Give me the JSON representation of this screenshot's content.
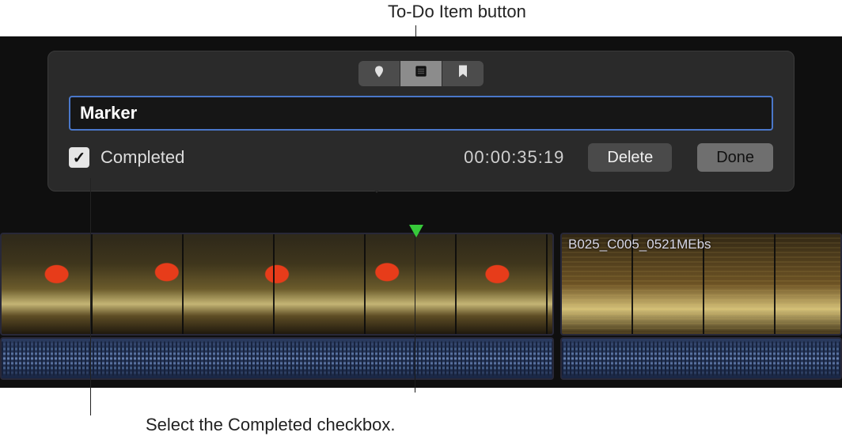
{
  "annotations": {
    "top": "To-Do Item button",
    "bottom": "Select the Completed checkbox."
  },
  "popover": {
    "segmented": {
      "standard_marker_icon": "marker-standard-icon",
      "todo_marker_icon": "marker-todo-icon",
      "chapter_marker_icon": "marker-chapter-icon",
      "selected": "todo"
    },
    "marker_name": "Marker",
    "completed": {
      "label": "Completed",
      "checked": true
    },
    "timecode": "00:00:35:19",
    "delete_label": "Delete",
    "done_label": "Done"
  },
  "timeline": {
    "clip2_name": "B025_C005_0521MEbs"
  }
}
